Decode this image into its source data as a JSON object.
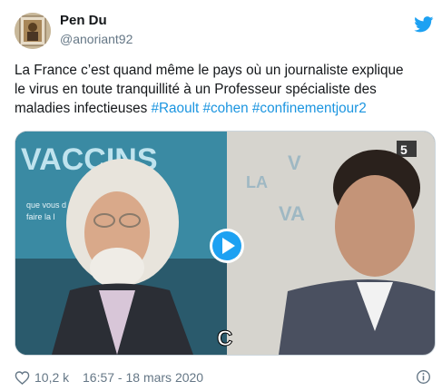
{
  "author": {
    "name": "Pen Du",
    "handle": "@anoriant92"
  },
  "tweet": {
    "text_lines": [
      "La France c’est quand même le pays où un journaliste explique",
      "le virus en toute tranquillité à un Professeur spécialiste des",
      "maladies infectieuses "
    ],
    "hashtags": [
      "#Raoult",
      "#cohen",
      "#confinementjour2"
    ]
  },
  "media": {
    "left_banner_text": "VACCINS",
    "left_subtext_1": "que vous d",
    "left_subtext_2": "faire la l",
    "right_banner_1": "LA",
    "right_banner_2": "V",
    "right_banner_3": "VA",
    "right_logo_text": "5",
    "channel_logo": "C",
    "play_button": "play-video"
  },
  "footer": {
    "likes": "10,2 k",
    "timestamp": "16:57 - 18 mars 2020"
  },
  "colors": {
    "link": "#1b95e0",
    "muted": "#657786",
    "twitter_blue": "#1da1f2"
  }
}
